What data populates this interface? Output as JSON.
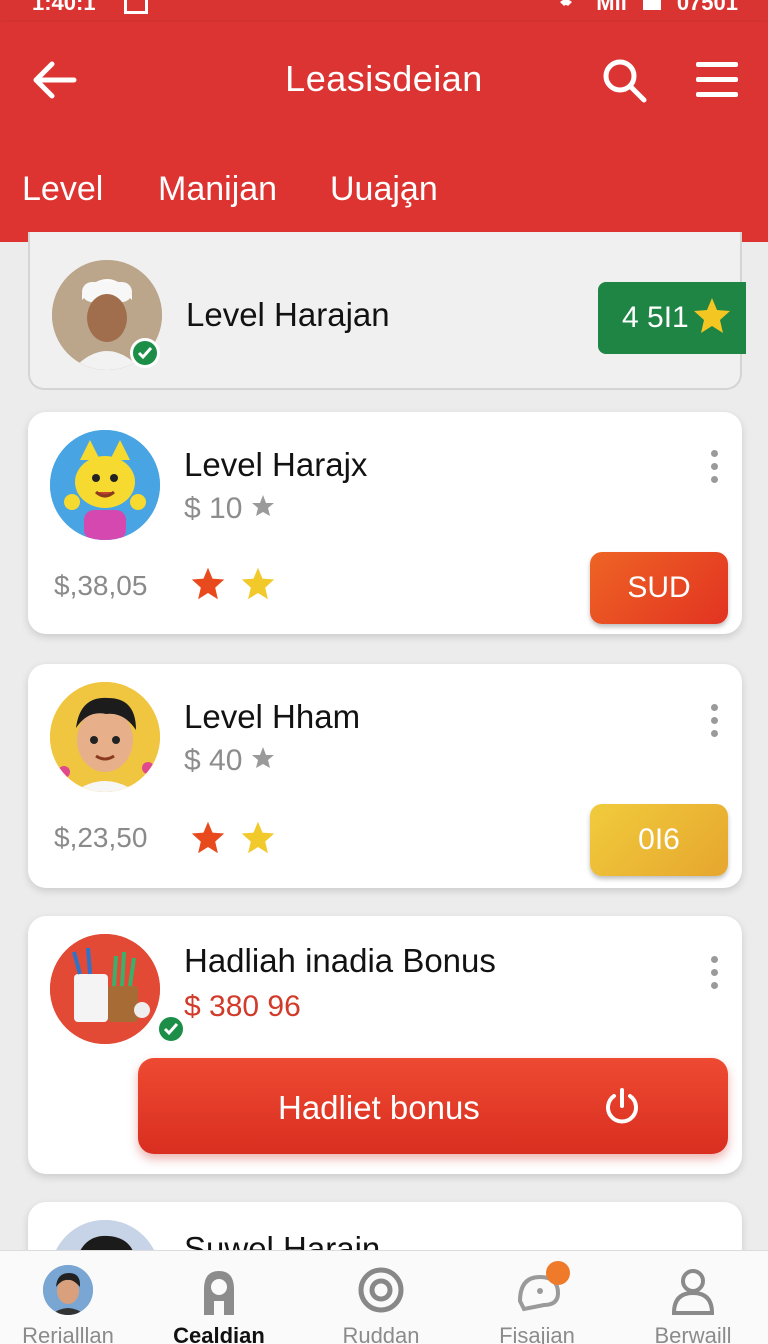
{
  "status_bar": {
    "time": "1:40:1",
    "carrier": "Mil",
    "right_text": "07501"
  },
  "app_bar": {
    "title": "Leasisdeian"
  },
  "tabs": [
    {
      "label": "Level"
    },
    {
      "label": "Manijan"
    },
    {
      "label": "Uuaja̧n"
    }
  ],
  "cards": [
    {
      "title": "Level Harajan",
      "badge": "4 5I1",
      "badge_color": "#1e8545"
    },
    {
      "title": "Level Harajx",
      "sub": "$ 10",
      "price": "$,38,05",
      "action": "SUD",
      "action_color": "#e8451f"
    },
    {
      "title": "Level Hham",
      "sub": "$ 40",
      "price": "$,23,50",
      "action": "0I6",
      "action_color": "#eab332"
    },
    {
      "title": "Hadliah inadia Bonus",
      "sub": "$ 380 96",
      "button": "Hadliet bonus"
    },
    {
      "title": "Suwel Harajn"
    }
  ],
  "bottom_nav": [
    {
      "label": "Rerialllan",
      "icon": "avatar-icon"
    },
    {
      "label": "Cealdian",
      "icon": "person-icon",
      "active": true
    },
    {
      "label": "Ruddan",
      "icon": "target-icon"
    },
    {
      "label": "Fisajian",
      "icon": "bird-icon"
    },
    {
      "label": "Berwaill",
      "icon": "profile-icon"
    }
  ],
  "colors": {
    "primary": "#dc3432",
    "success": "#1e8545",
    "accent_orange": "#e8451f",
    "accent_yellow": "#eab332"
  }
}
